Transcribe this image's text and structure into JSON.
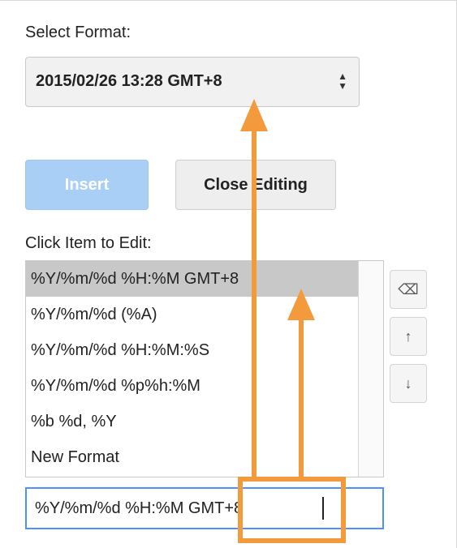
{
  "select_format_label": "Select Format:",
  "format_select": {
    "value": "2015/02/26 13:28 GMT+8",
    "arrows": "▲▼"
  },
  "buttons": {
    "insert": "Insert",
    "close_editing": "Close Editing"
  },
  "click_item_label": "Click Item to Edit:",
  "format_list": {
    "items": [
      "%Y/%m/%d %H:%M GMT+8",
      "%Y/%m/%d (%A)",
      "%Y/%m/%d %H:%M:%S",
      "%Y/%m/%d %p%h:%M",
      "%b %d, %Y",
      "New Format"
    ],
    "selected_index": 0
  },
  "side_buttons": {
    "delete": "⌫",
    "move_up": "↑",
    "move_down": "↓"
  },
  "edit_field": {
    "value": "%Y/%m/%d %H:%M GMT+8"
  },
  "colors": {
    "annotation_orange": "#f39a3c",
    "insert_disabled_bg": "#a9cff6",
    "selected_row_bg": "#c8c8c8",
    "focus_border": "#4d90fe"
  }
}
